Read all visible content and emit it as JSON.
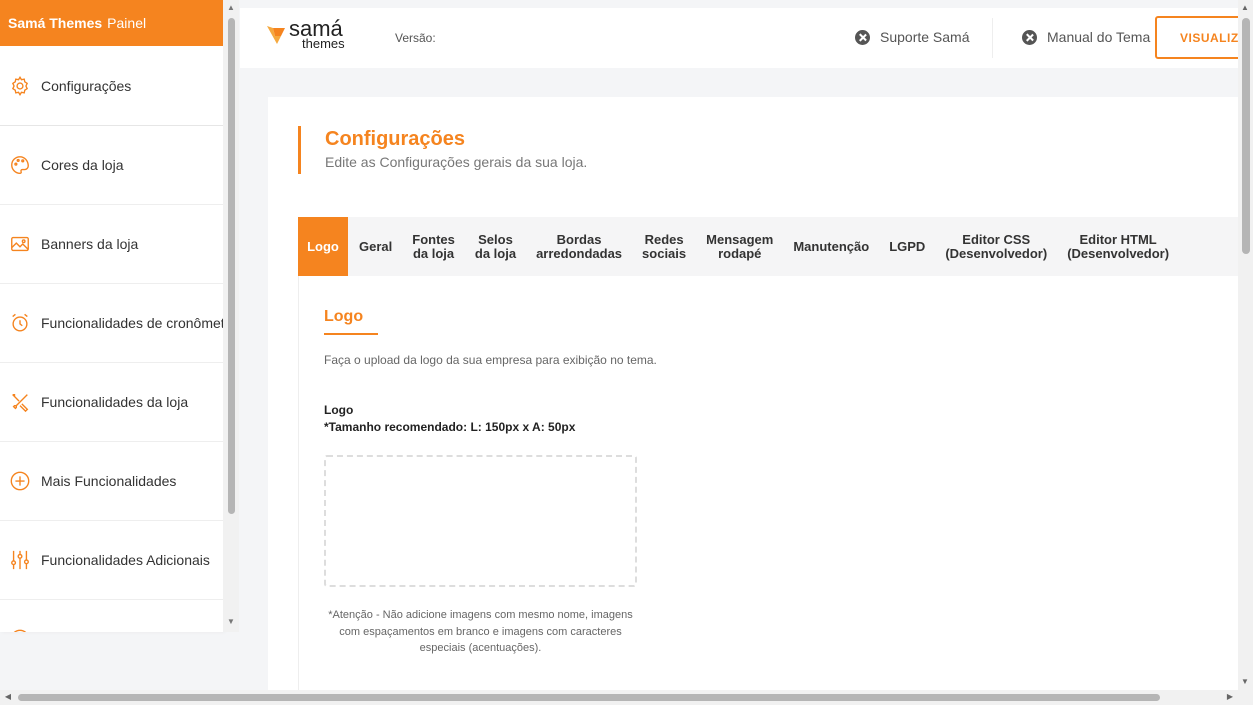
{
  "sidebar": {
    "brand": "Samá Themes",
    "subtitle": "Painel",
    "items": [
      {
        "label": "Configurações",
        "icon": "gear-icon"
      },
      {
        "label": "Cores da loja",
        "icon": "palette-icon"
      },
      {
        "label": "Banners da loja",
        "icon": "image-icon"
      },
      {
        "label": "Funcionalidades de cronômet",
        "icon": "alarm-clock-icon"
      },
      {
        "label": "Funcionalidades da loja",
        "icon": "tools-icon"
      },
      {
        "label": "Mais Funcionalidades",
        "icon": "plus-circle-icon"
      },
      {
        "label": "Funcionalidades Adicionais",
        "icon": "sliders-icon"
      }
    ]
  },
  "header": {
    "logo_top": "samá",
    "logo_bottom": "themes",
    "version_label": "Versão:",
    "support_link": "Suporte Samá",
    "manual_link": "Manual do Tema",
    "visualize_button": "VISUALIZAR"
  },
  "page": {
    "title": "Configurações",
    "subtitle": "Edite as Configurações gerais da sua loja."
  },
  "tabs": [
    {
      "label": "Logo",
      "active": true
    },
    {
      "label": "Geral"
    },
    {
      "label": "Fontes\nda loja"
    },
    {
      "label": "Selos\nda loja"
    },
    {
      "label": "Bordas\narredondadas"
    },
    {
      "label": "Redes\nsociais"
    },
    {
      "label": "Mensagem\nrodapé"
    },
    {
      "label": "Manutenção"
    },
    {
      "label": "LGPD"
    },
    {
      "label": "Editor CSS\n(Desenvolvedor)"
    },
    {
      "label": "Editor HTML\n(Desenvolvedor)"
    }
  ],
  "panel": {
    "heading": "Logo",
    "description": "Faça o upload da logo da sua empresa para exibição no tema.",
    "field_label": "Logo",
    "field_hint": "*Tamanho recomendado: L: 150px x A: 50px",
    "note": "*Atenção - Não adicione imagens com mesmo nome, imagens com espaçamentos em branco e imagens com caracteres especiais (acentuações)."
  },
  "colors": {
    "accent": "#f5841f"
  }
}
